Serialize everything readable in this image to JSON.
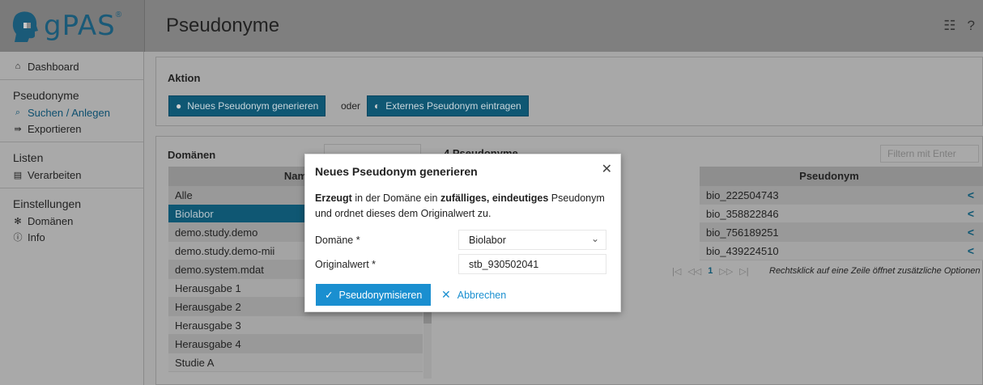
{
  "app": {
    "logo_text": "gPAS",
    "logo_reg": "®",
    "page_title": "Pseudonyme"
  },
  "sidebar": {
    "dashboard": "Dashboard",
    "group_pseudonyme": "Pseudonyme",
    "suchen": "Suchen / Anlegen",
    "exportieren": "Exportieren",
    "group_listen": "Listen",
    "verarbeiten": "Verarbeiten",
    "group_einstellungen": "Einstellungen",
    "domaenen": "Domänen",
    "info": "Info"
  },
  "aktion": {
    "title": "Aktion",
    "btn_generate": "Neues Pseudonym generieren",
    "oder": "oder",
    "btn_external": "Externes Pseudonym eintragen"
  },
  "domains": {
    "title": "Domänen",
    "header": "Nam",
    "rows": [
      "Alle",
      "Biolabor",
      "demo.study.demo",
      "demo.study.demo-mii",
      "demo.system.mdat",
      "Herausgabe 1",
      "Herausgabe 2",
      "Herausgabe 3",
      "Herausgabe 4",
      "Studie A"
    ]
  },
  "pseudonyms": {
    "count_label": "4 Pseudonyme",
    "filter_placeholder": "Filtern mit Enter",
    "header": "Pseudonym",
    "rows": [
      "bio_222504743",
      "bio_358822846",
      "bio_756189251",
      "bio_439224510"
    ],
    "pager_page": "1",
    "pager_hint": "Rechtsklick auf eine Zeile öffnet zusätzliche Optionen"
  },
  "dialog": {
    "title": "Neues Pseudonym generieren",
    "desc_b1": "Erzeugt",
    "desc_t1": " in der Domäne ein ",
    "desc_b2": "zufälliges, eindeutiges",
    "desc_t2": " Pseudonym und ordnet dieses dem Originalwert zu.",
    "label_domain": "Domäne *",
    "domain_value": "Biolabor",
    "label_original": "Originalwert *",
    "original_value": "stb_930502041",
    "btn_submit": "Pseudonymisieren",
    "btn_cancel": "Abbrechen"
  }
}
